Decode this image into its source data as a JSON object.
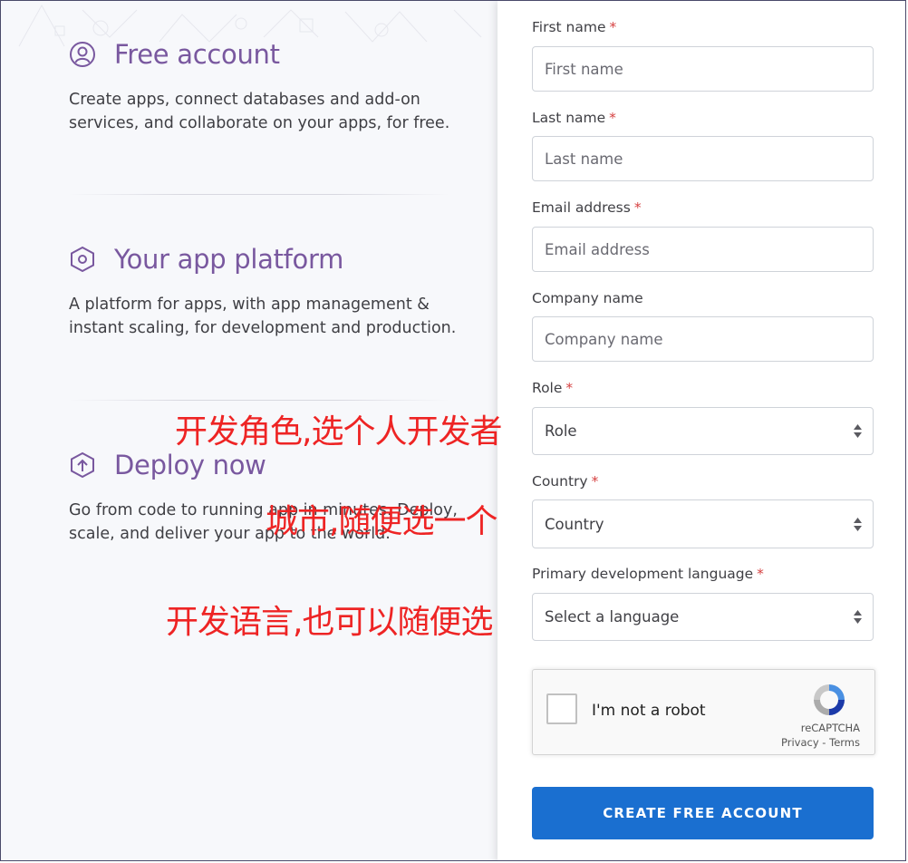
{
  "features": [
    {
      "title": "Free account",
      "desc": "Create apps, connect databases and add-on services, and collaborate on your apps, for free.",
      "icon": "user-circle-icon"
    },
    {
      "title": "Your app platform",
      "desc": "A platform for apps, with app management & instant scaling, for development and production.",
      "icon": "hexagon-icon"
    },
    {
      "title": "Deploy now",
      "desc": "Go from code to running app in minutes. Deploy, scale, and deliver your app to the world.",
      "icon": "upload-shield-icon"
    }
  ],
  "form": {
    "first_name": {
      "label": "First name",
      "placeholder": "First name",
      "required": "*"
    },
    "last_name": {
      "label": "Last name",
      "placeholder": "Last name",
      "required": "*"
    },
    "email": {
      "label": "Email address",
      "placeholder": "Email address",
      "required": "*"
    },
    "company": {
      "label": "Company name",
      "placeholder": "Company name"
    },
    "role": {
      "label": "Role",
      "value": "Role",
      "required": "*"
    },
    "country": {
      "label": "Country",
      "value": "Country",
      "required": "*"
    },
    "language": {
      "label": "Primary development language",
      "value": "Select a language",
      "required": "*"
    },
    "captcha": {
      "label": "I'm not a robot",
      "brand": "reCAPTCHA",
      "privacy": "Privacy",
      "separator": " - ",
      "terms": "Terms"
    },
    "submit_label": "CREATE FREE ACCOUNT"
  },
  "annotations": {
    "role_note": "开发角色,选个人开发者",
    "country_note": "城市,随便选一个",
    "language_note": "开发语言,也可以随便选"
  },
  "colors": {
    "accent": "#79589f",
    "button": "#1a6fd0",
    "required": "#d64242",
    "annotation": "#ee2424"
  }
}
